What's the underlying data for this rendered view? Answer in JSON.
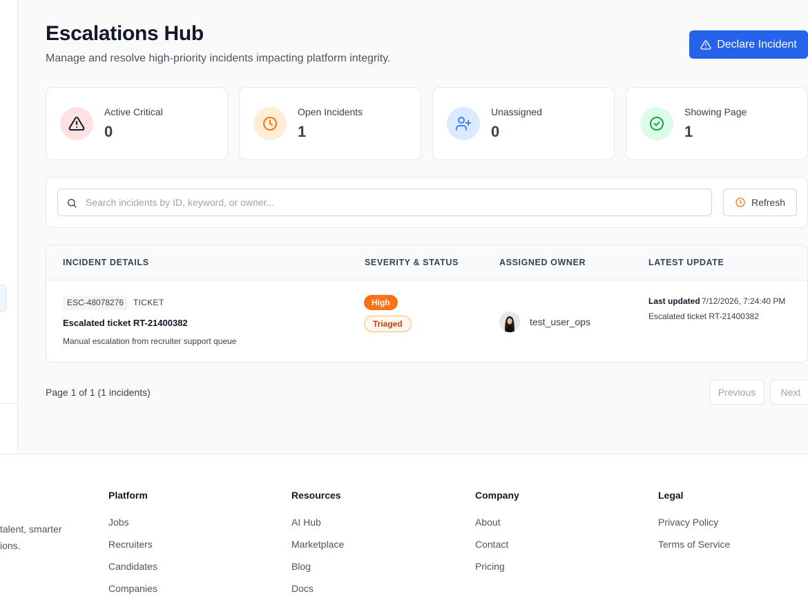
{
  "header": {
    "title": "Escalations Hub",
    "subtitle": "Manage and resolve high-priority incidents impacting platform integrity.",
    "declare_label": "Declare Incident"
  },
  "stats": [
    {
      "label": "Active Critical",
      "value": "0",
      "icon": "alert-triangle-icon",
      "color": "#dc2626",
      "bg": "#fee2e2"
    },
    {
      "label": "Open Incidents",
      "value": "1",
      "icon": "clock-icon",
      "color": "#f97316",
      "bg": "#ffedd5"
    },
    {
      "label": "Unassigned",
      "value": "0",
      "icon": "user-plus-icon",
      "color": "#3b82f6",
      "bg": "#dbeafe"
    },
    {
      "label": "Showing Page",
      "value": "1",
      "icon": "check-circle-icon",
      "color": "#16a34a",
      "bg": "#dcfce7"
    }
  ],
  "search": {
    "placeholder": "Search incidents by ID, keyword, or owner...",
    "value": "",
    "refresh_label": "Refresh"
  },
  "table": {
    "columns": [
      "INCIDENT DETAILS",
      "SEVERITY & STATUS",
      "ASSIGNED OWNER",
      "LATEST UPDATE"
    ],
    "rows": [
      {
        "id": "ESC-48078276",
        "type": "TICKET",
        "title": "Escalated ticket RT-21400382",
        "description": "Manual escalation from recruiter support queue",
        "severity": "High",
        "status": "Triaged",
        "owner": "test_user_ops",
        "updated_label": "Last updated",
        "updated_time": "7/12/2026, 7:24:40 PM",
        "update_text": "Escalated ticket RT-21400382"
      }
    ]
  },
  "pagination": {
    "info": "Page 1 of 1 (1 incidents)",
    "previous_label": "Previous",
    "next_label": "Next"
  },
  "footer": {
    "tagline_lines": [
      "l talent, smarter",
      "sions."
    ],
    "columns": [
      {
        "title": "Platform",
        "links": [
          "Jobs",
          "Recruiters",
          "Candidates",
          "Companies"
        ]
      },
      {
        "title": "Resources",
        "links": [
          "AI Hub",
          "Marketplace",
          "Blog",
          "Docs"
        ]
      },
      {
        "title": "Company",
        "links": [
          "About",
          "Contact",
          "Pricing"
        ]
      },
      {
        "title": "Legal",
        "links": [
          "Privacy Policy",
          "Terms of Service"
        ]
      }
    ]
  },
  "colors": {
    "primary": "#2563eb",
    "severity_high": "#f97316",
    "status_triaged": "#c2410c"
  }
}
